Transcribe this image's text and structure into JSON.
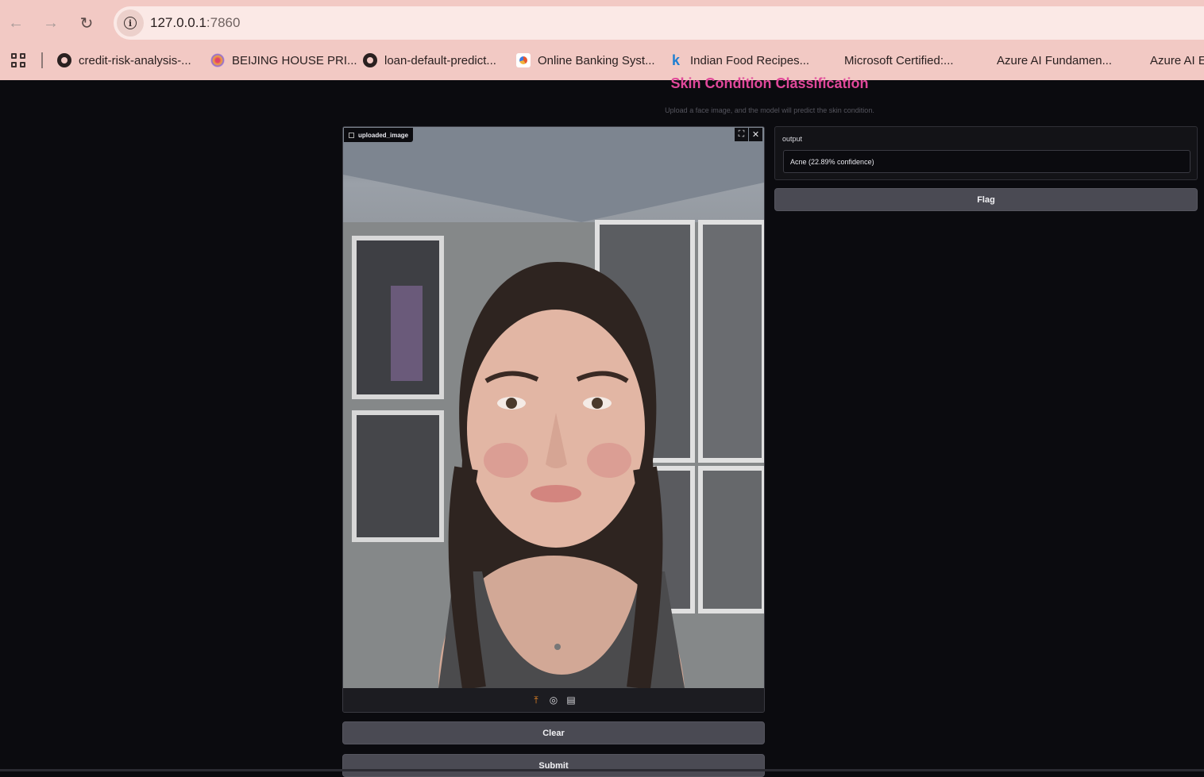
{
  "browser": {
    "url_host": "127.0.0.1",
    "url_port": ":7860",
    "bookmarks": [
      {
        "label": "credit-risk-analysis-...",
        "icon": "github-icon"
      },
      {
        "label": "BEIJING HOUSE PRI...",
        "icon": "dots-icon"
      },
      {
        "label": "loan-default-predict...",
        "icon": "github-icon"
      },
      {
        "label": "Online Banking Syst...",
        "icon": "chart-icon"
      },
      {
        "label": "Indian Food Recipes...",
        "icon": "kaggle-icon"
      },
      {
        "label": "Microsoft Certified:...",
        "icon": "microsoft-icon"
      },
      {
        "label": "Azure AI Fundamen...",
        "icon": "microsoft-icon"
      },
      {
        "label": "Azure AI E",
        "icon": "microsoft-icon"
      }
    ]
  },
  "app": {
    "title": "Skin Condition Classification",
    "subtitle": "Upload a face image, and the model will predict the skin condition.",
    "accent_color": "#e0489a"
  },
  "input": {
    "label": "uploaded_image",
    "sources": [
      "upload-icon",
      "webcam-icon",
      "clipboard-icon"
    ]
  },
  "output": {
    "label": "output",
    "value": "Acne (22.89% confidence)"
  },
  "buttons": {
    "clear": "Clear",
    "submit": "Submit",
    "flag": "Flag"
  }
}
